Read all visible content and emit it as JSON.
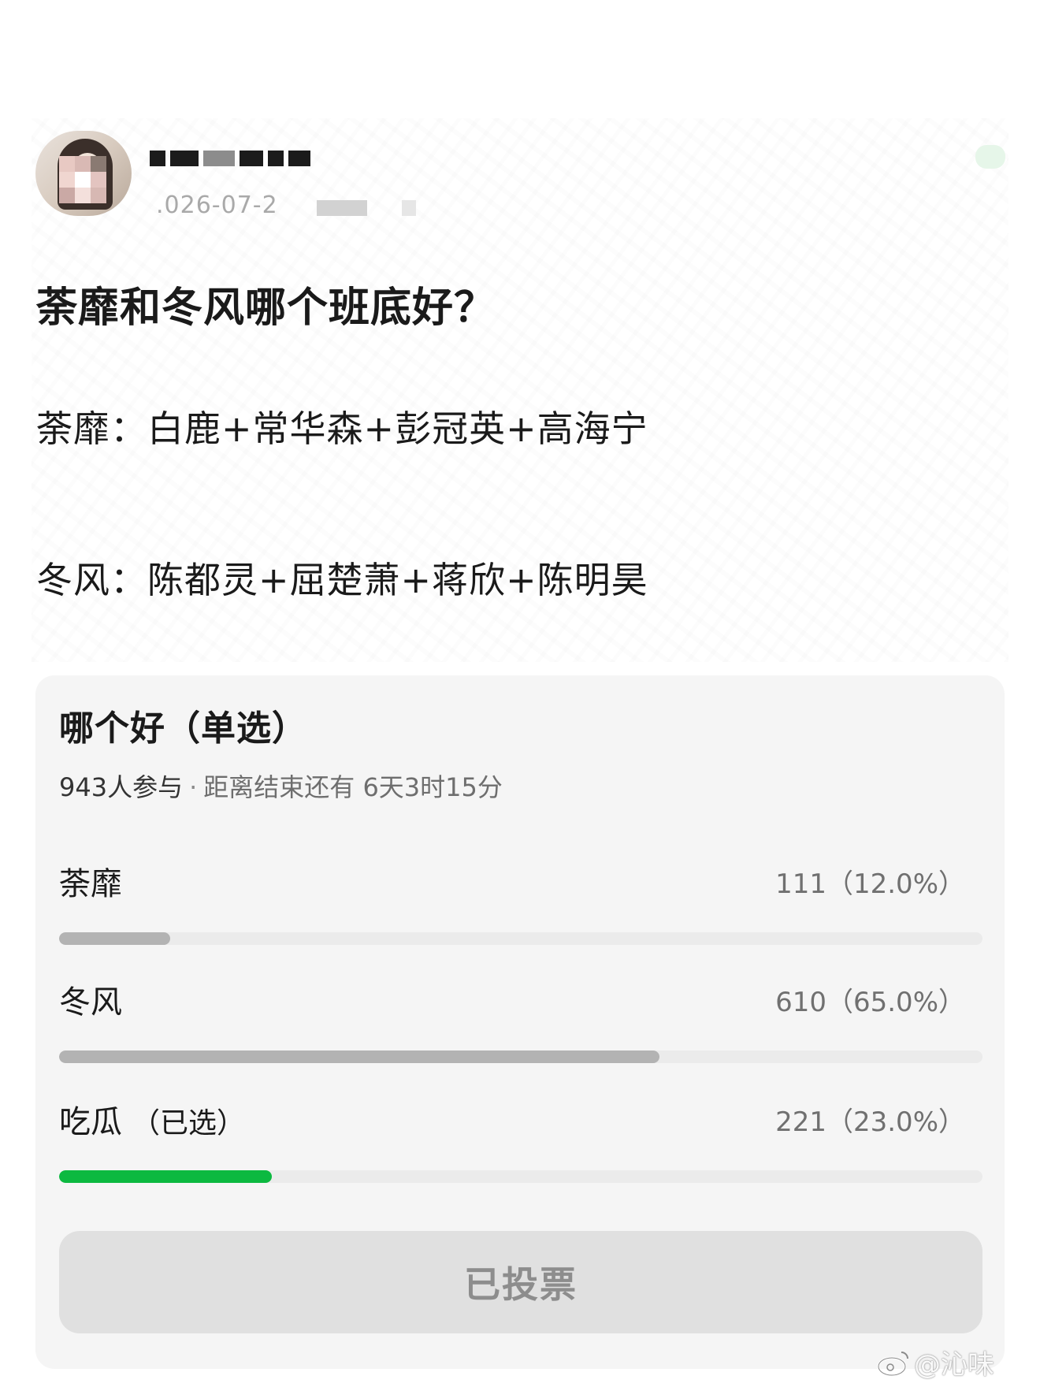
{
  "post": {
    "meta_fragment": ".026-07-2",
    "title": "荼靡和冬风哪个班底好？",
    "lines": [
      "荼靡：白鹿+常华森+彭冠英+高海宁",
      "冬风：陈都灵+屈楚萧+蒋欣+陈明昊"
    ]
  },
  "poll": {
    "title": "哪个好（单选）",
    "participants": "943人参与",
    "deadline": "距离结束还有 6天3时15分",
    "options": [
      {
        "label": "荼靡",
        "tag": "",
        "count": "111（12.0%）",
        "fraction": 0.12,
        "selected": false
      },
      {
        "label": "冬风",
        "tag": "",
        "count": "610（65.0%）",
        "fraction": 0.65,
        "selected": false
      },
      {
        "label": "吃瓜",
        "tag": "（已选）",
        "count": "221（23.0%）",
        "fraction": 0.23,
        "selected": true
      }
    ],
    "button_label": "已投票"
  },
  "watermark": "@沁味",
  "colors": {
    "selected_bar": "#0cb940",
    "unselected_bar": "#b3b3b3",
    "card_bg": "#f5f5f5"
  },
  "icons": {
    "avatar": "blurred-avatar",
    "watermark_icon": "weibo-icon"
  }
}
